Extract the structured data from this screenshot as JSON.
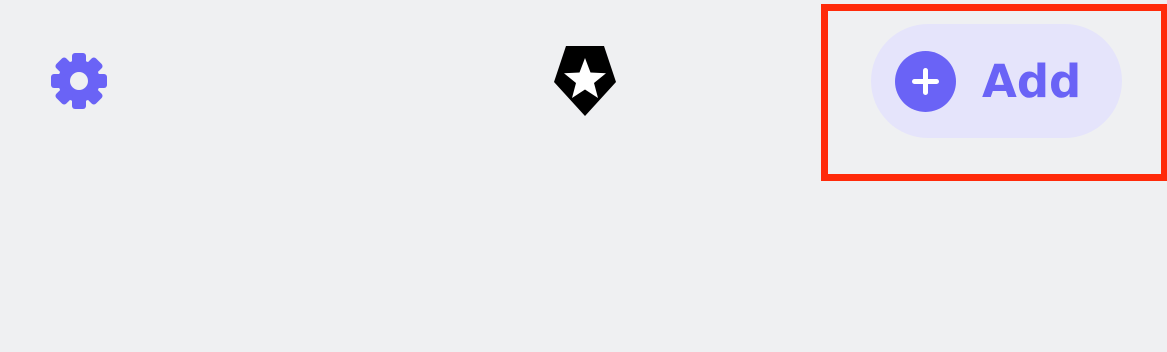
{
  "toolbar": {
    "settings_icon": "gear-icon",
    "logo_icon": "shield-star-icon",
    "add_button": {
      "label": "Add",
      "icon": "plus-circle-icon"
    }
  },
  "colors": {
    "accent": "#6a63f6",
    "button_bg": "#e5e4fb",
    "background": "#eff0f2",
    "highlight": "#ff2a0a",
    "logo": "#000000"
  }
}
